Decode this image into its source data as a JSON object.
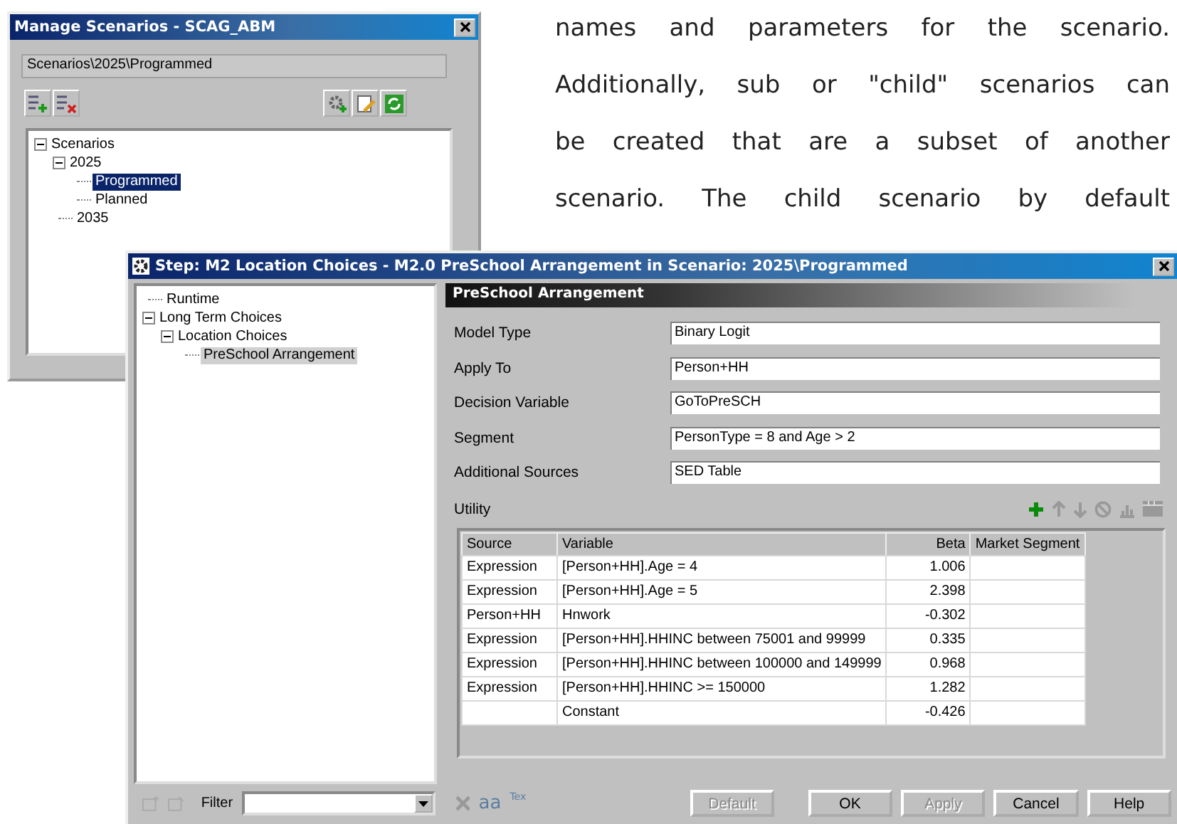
{
  "document_text": {
    "lines": [
      "names and parameters for the scenario.",
      "Additionally, sub or \"child\" scenarios can",
      "be created that are a subset of another",
      "scenario. The child scenario by default"
    ]
  },
  "manage_window": {
    "title": "Manage Scenarios - SCAG_ABM",
    "path": "Scenarios\\2025\\Programmed",
    "tree": [
      {
        "label": "Scenarios",
        "selected": false,
        "expanded": true,
        "children": [
          {
            "label": "2025",
            "selected": false,
            "expanded": true,
            "children": [
              {
                "label": "Programmed",
                "selected": true
              },
              {
                "label": "Planned",
                "selected": false
              }
            ]
          },
          {
            "label": "2035",
            "selected": false
          }
        ]
      }
    ]
  },
  "step_window": {
    "title": "Step: M2 Location Choices - M2.0 PreSchool Arrangement in Scenario: 2025\\Programmed",
    "tree": [
      {
        "label": "Runtime",
        "selected": false
      },
      {
        "label": "Long Term Choices",
        "selected": false,
        "expanded": true,
        "children": [
          {
            "label": "Location Choices",
            "selected": false,
            "expanded": true,
            "children": [
              {
                "label": "PreSchool Arrangement",
                "selected": true
              }
            ]
          }
        ]
      }
    ],
    "panel_title": "PreSchool Arrangement",
    "fields": [
      {
        "label": "Model Type",
        "value": "Binary Logit"
      },
      {
        "label": "Apply To",
        "value": "Person+HH"
      },
      {
        "label": "Decision Variable",
        "value": "GoToPreSCH"
      },
      {
        "label": "Segment",
        "value": "PersonType = 8 and Age > 2"
      },
      {
        "label": "Additional Sources",
        "value": "SED Table"
      }
    ],
    "utility_label": "Utility",
    "table": {
      "columns": [
        "Source",
        "Variable",
        "Beta",
        "Market Segment"
      ],
      "rows": [
        {
          "source": "Expression",
          "variable": "[Person+HH].Age = 4",
          "beta": "1.006"
        },
        {
          "source": "Expression",
          "variable": "[Person+HH].Age = 5",
          "beta": "2.398"
        },
        {
          "source": "Person+HH",
          "variable": "Hnwork",
          "beta": "-0.302"
        },
        {
          "source": "Expression",
          "variable": "[Person+HH].HHINC between 75001 and 99999",
          "beta": "0.335"
        },
        {
          "source": "Expression",
          "variable": "[Person+HH].HHINC between 100000 and 149999",
          "beta": "0.968"
        },
        {
          "source": "Expression",
          "variable": "[Person+HH].HHINC >= 150000",
          "beta": "1.282"
        },
        {
          "variable": "Constant",
          "beta": "-0.426"
        }
      ]
    },
    "filter_label": "Filter",
    "text_tools": [
      "aa",
      "Tex"
    ],
    "buttons": [
      {
        "label": "Default",
        "disabled": true
      },
      {
        "label": "OK",
        "disabled": false
      },
      {
        "label": "Apply",
        "disabled": true
      },
      {
        "label": "Cancel",
        "disabled": false
      },
      {
        "label": "Help",
        "disabled": false
      }
    ]
  }
}
